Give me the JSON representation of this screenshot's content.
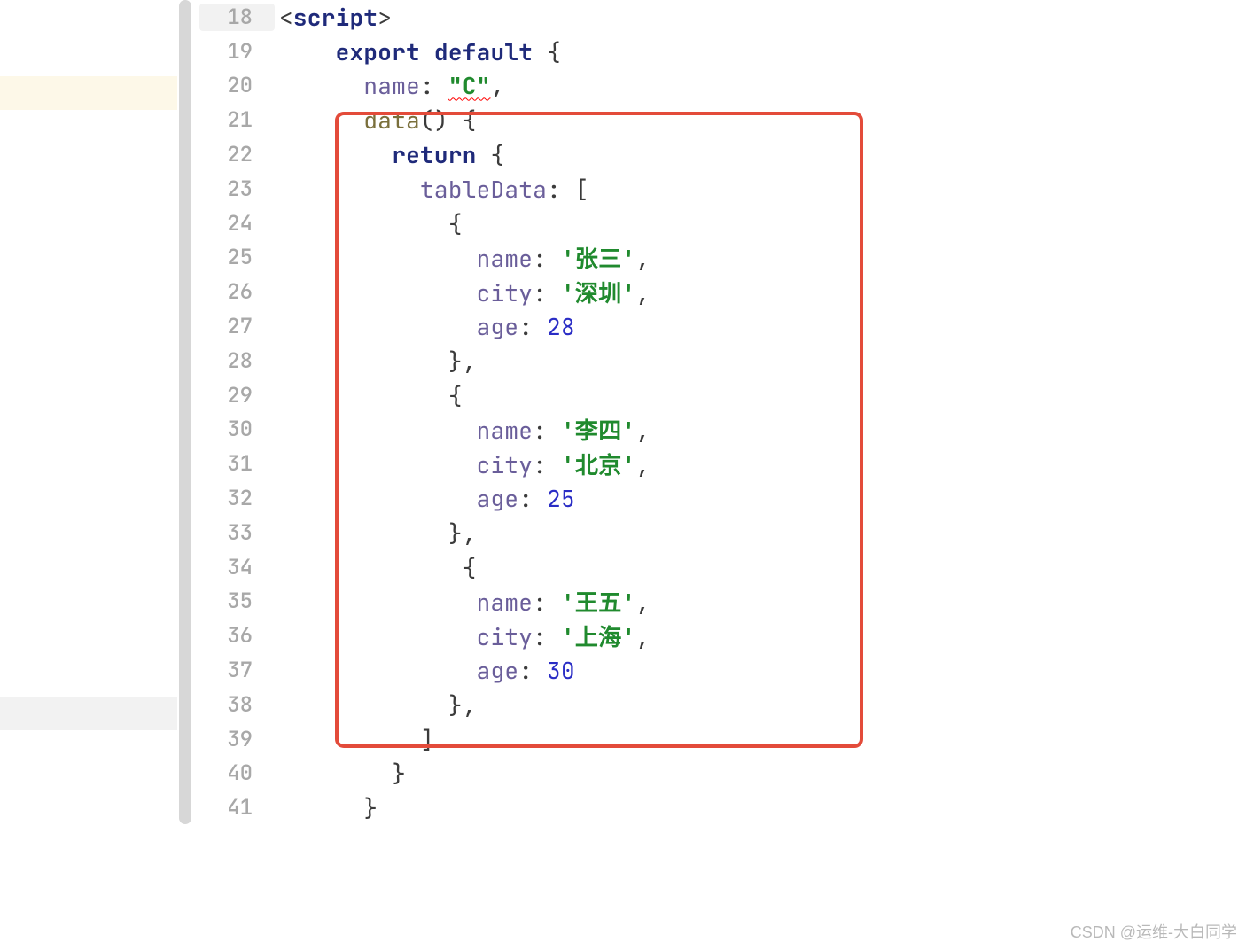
{
  "gutterStart": 18,
  "watermark": "CSDN @运维-大白同学",
  "code": {
    "l18": {
      "tagOpen": "<",
      "tagName": "script",
      "tagClose": ">"
    },
    "l19": {
      "kwExport": "export",
      "kwDefault": "default",
      "brace": " {"
    },
    "l20": {
      "prop": "name",
      "colon": ": ",
      "val": "\"C\"",
      "comma": ","
    },
    "l21": {
      "fn": "data",
      "paren": "()",
      "brace": " {"
    },
    "l22": {
      "kw": "return",
      "brace": " {"
    },
    "l23": {
      "prop": "tableData",
      "colon": ": ",
      "bracket": "["
    },
    "l24": {
      "brace": "{"
    },
    "l25": {
      "prop": "name",
      "colon": ": ",
      "val": "'张三'",
      "comma": ","
    },
    "l26": {
      "prop": "city",
      "colon": ": ",
      "val": "'深圳'",
      "comma": ","
    },
    "l27": {
      "prop": "age",
      "colon": ": ",
      "val": "28"
    },
    "l28": {
      "brace": "},"
    },
    "l29": {
      "brace": "{"
    },
    "l30": {
      "prop": "name",
      "colon": ": ",
      "val": "'李四'",
      "comma": ","
    },
    "l31": {
      "prop": "city",
      "colon": ": ",
      "val": "'北京'",
      "comma": ","
    },
    "l32": {
      "prop": "age",
      "colon": ": ",
      "val": "25"
    },
    "l33": {
      "brace": "},"
    },
    "l34": {
      "brace": " {"
    },
    "l35": {
      "prop": "name",
      "colon": ": ",
      "val": "'王五'",
      "comma": ","
    },
    "l36": {
      "prop": "city",
      "colon": ": ",
      "val": "'上海'",
      "comma": ","
    },
    "l37": {
      "prop": "age",
      "colon": ": ",
      "val": "30"
    },
    "l38": {
      "brace": "},"
    },
    "l39": {
      "bracket": "]"
    },
    "l40": {
      "brace": "}"
    },
    "l41": {
      "brace": "}"
    }
  },
  "lineNumbers": [
    "18",
    "19",
    "20",
    "21",
    "22",
    "23",
    "24",
    "25",
    "26",
    "27",
    "28",
    "29",
    "30",
    "31",
    "32",
    "33",
    "34",
    "35",
    "36",
    "37",
    "38",
    "39",
    "40",
    "41"
  ]
}
